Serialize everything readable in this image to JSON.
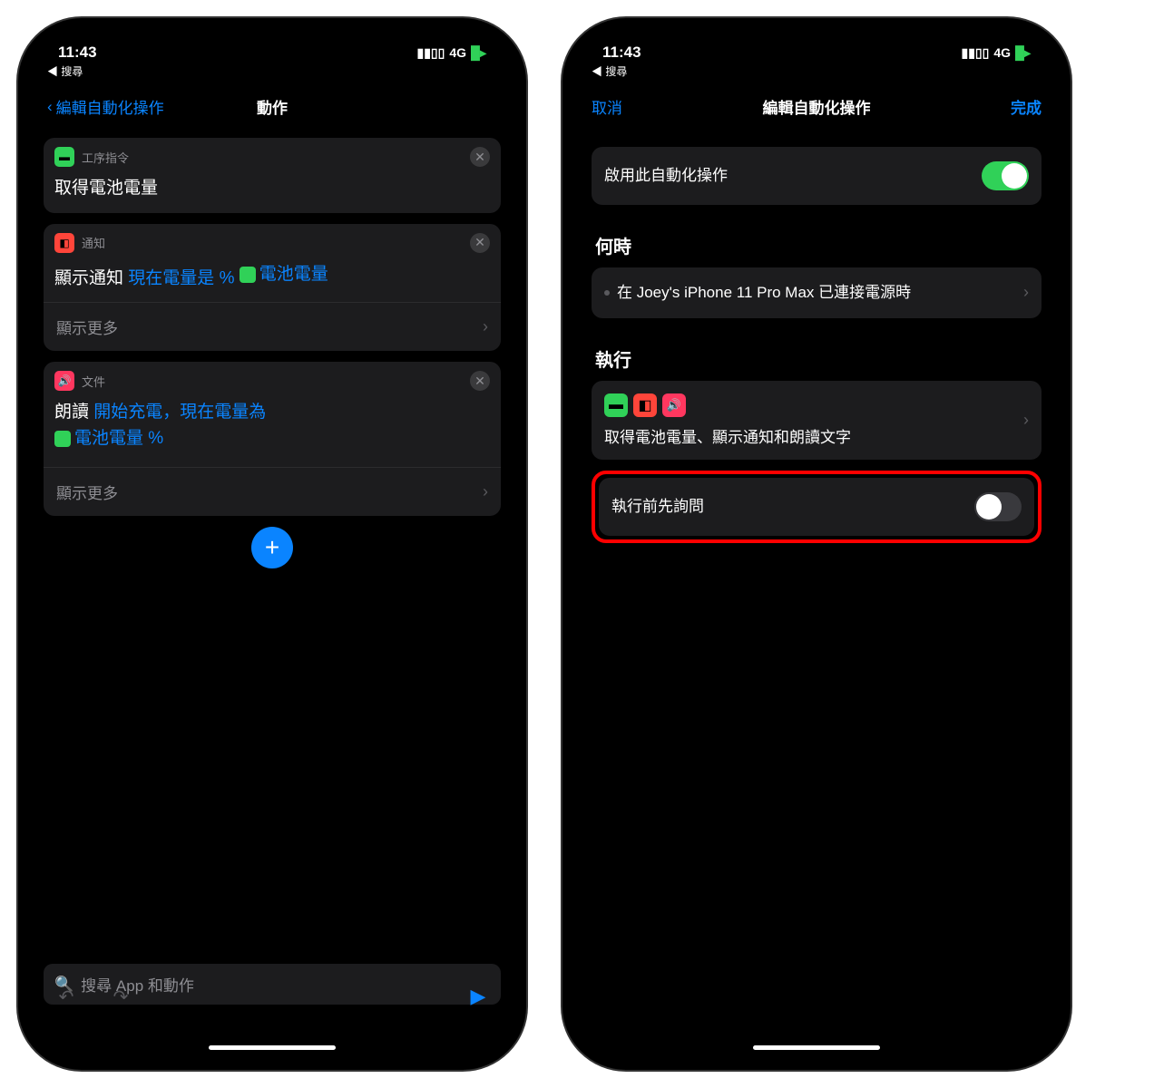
{
  "status": {
    "time": "11:43",
    "net": "4G",
    "back_search": "搜尋"
  },
  "left": {
    "nav_back": "編輯自動化操作",
    "nav_title": "動作",
    "card1": {
      "label": "工序指令",
      "title": "取得電池電量"
    },
    "card2": {
      "label": "通知",
      "prefix": "顯示通知",
      "text": "現在電量是 %",
      "token": "電池電量",
      "more": "顯示更多"
    },
    "card3": {
      "label": "文件",
      "prefix": "朗讀",
      "text": "開始充電，現在電量為",
      "token": "電池電量 %",
      "more": "顯示更多"
    },
    "search_placeholder": "搜尋 App 和動作"
  },
  "right": {
    "cancel": "取消",
    "title": "編輯自動化操作",
    "done": "完成",
    "enable_label": "啟用此自動化操作",
    "section_when": "何時",
    "when_text": "在 Joey's iPhone 11 Pro Max 已連接電源時",
    "section_do": "執行",
    "do_text": "取得電池電量、顯示通知和朗讀文字",
    "ask_label": "執行前先詢問"
  }
}
